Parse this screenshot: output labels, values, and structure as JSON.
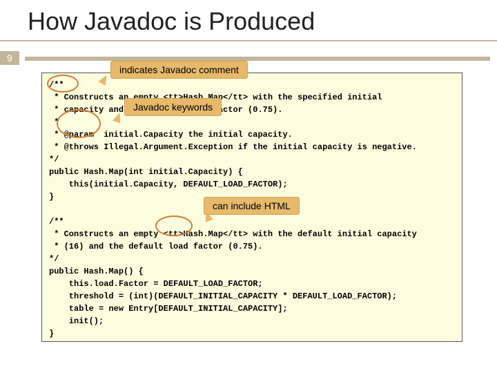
{
  "title": "How Javadoc is Produced",
  "page_number": "9",
  "callouts": {
    "c1": "indicates Javadoc comment",
    "c2": "Javadoc keywords",
    "c3": "can include HTML"
  },
  "code": "/**\n * Constructs an empty <tt>Hash.Map</tt> with the specified initial\n * capacity and the default load factor (0.75).\n *\n * @param  initial.Capacity the initial capacity.\n * @throws Illegal.Argument.Exception if the initial capacity is negative.\n*/\npublic Hash.Map(int initial.Capacity) {\n    this(initial.Capacity, DEFAULT_LOAD_FACTOR);\n}\n\n/**\n * Constructs an empty <tt>Hash.Map</tt> with the default initial capacity\n * (16) and the default load factor (0.75).\n*/\npublic Hash.Map() {\n    this.load.Factor = DEFAULT_LOAD_FACTOR;\n    threshold = (int)(DEFAULT_INITIAL_CAPACITY * DEFAULT_LOAD_FACTOR);\n    table = new Entry[DEFAULT_INITIAL_CAPACITY];\n    init();\n}"
}
